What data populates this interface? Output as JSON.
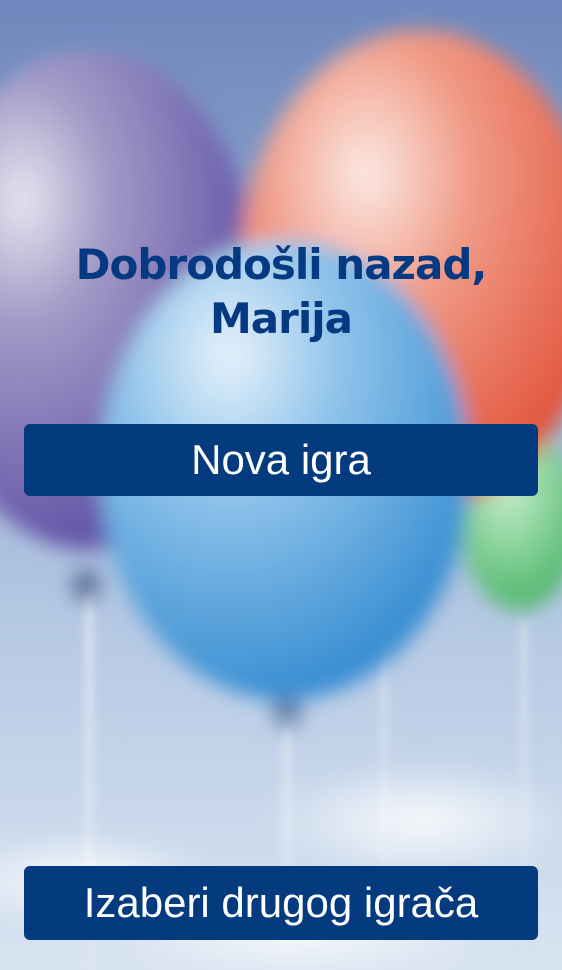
{
  "welcome": {
    "line1": "Dobrodošli nazad,",
    "line2": "Marija"
  },
  "buttons": {
    "new_game": "Nova igra",
    "choose_player": "Izaberi drugog igrača"
  },
  "colors": {
    "title": "#053a82",
    "button_bg": "#043b7f",
    "button_text": "#ffffff"
  },
  "background": {
    "image": "balloons-icon"
  }
}
